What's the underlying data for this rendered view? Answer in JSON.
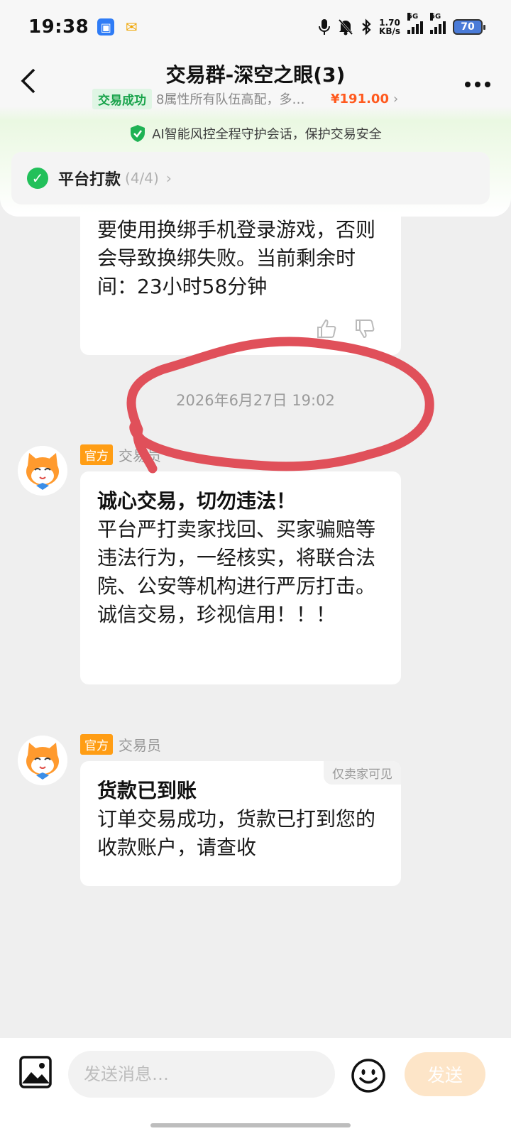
{
  "status_bar": {
    "time": "19:38",
    "net_speed_value": "1.70",
    "net_speed_unit": "KB/s",
    "signal_1_label": "5G",
    "signal_2_label": "5G",
    "battery": "70",
    "icons": [
      "app-icon-blue",
      "delivery-icon",
      "mic-icon",
      "bell-off-icon",
      "bluetooth-icon",
      "signal-icon",
      "battery-icon"
    ]
  },
  "nav": {
    "title": "交易群-深空之眼(3)",
    "deal_status": "交易成功",
    "deal_desc": "8属性所有队伍高配，多…",
    "deal_price": "¥191.00"
  },
  "ai_banner": {
    "text": "AI智能风控全程守护会话，保护交易安全"
  },
  "progress": {
    "label": "平台打款",
    "count": "(4/4)"
  },
  "messages": {
    "prev_body": "要使用换绑手机登录游戏，否则会导致换绑失败。当前剩余时间：23小时58分钟",
    "timestamp": "2026年6月27日 19:02",
    "msg1": {
      "tag": "官方",
      "sender": "交易员",
      "title": "诚心交易，切勿违法！",
      "body": "平台严打卖家找回、买家骗赔等违法行为，一经核实，将联合法院、公安等机构进行严厉打击。诚信交易，珍视信用！！！"
    },
    "msg2": {
      "tag": "官方",
      "sender": "交易员",
      "visibility": "仅卖家可见",
      "title": "货款已到账",
      "body": "订单交易成功，货款已打到您的收款账户，请查收"
    }
  },
  "input": {
    "placeholder": "发送消息…",
    "send_label": "发送"
  },
  "colors": {
    "accent_green": "#22c05a",
    "price_orange": "#ff5a1f",
    "official_orange": "#ff9d14",
    "annotation_red": "#e0505a",
    "send_disabled": "#fde5c8"
  }
}
